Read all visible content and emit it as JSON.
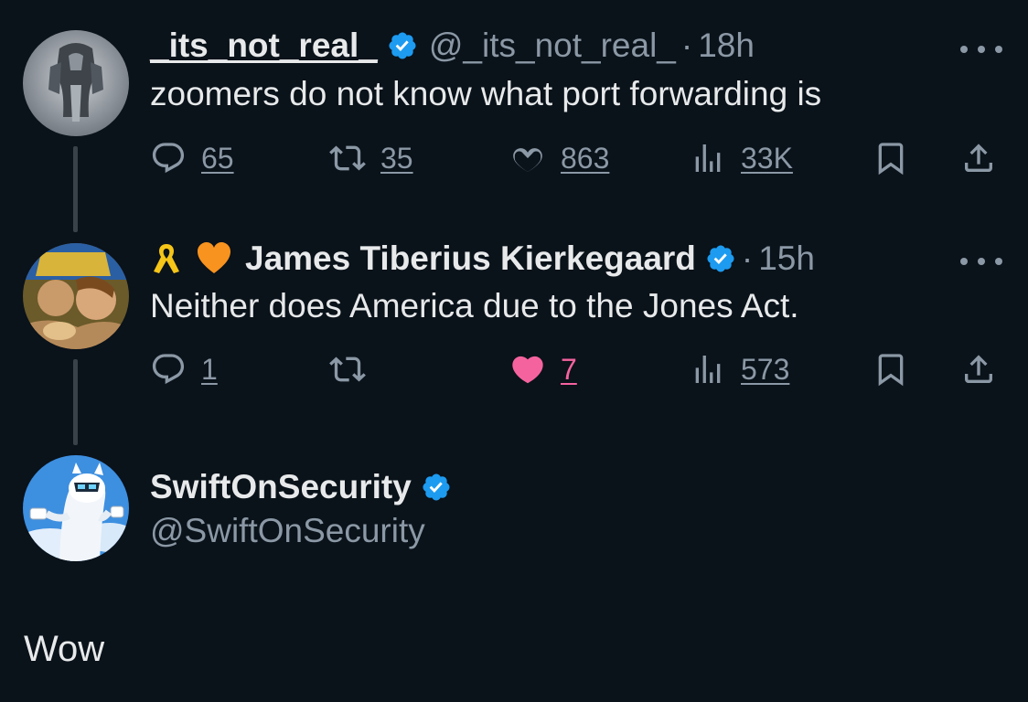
{
  "tweets": [
    {
      "name": "_its_not_real_",
      "handle": "@_its_not_real_",
      "separator": "·",
      "time": "18h",
      "text": "zoomers do not know what port forwarding is",
      "reply_count": "65",
      "retweet_count": "35",
      "like_count": "863",
      "view_count": "33K",
      "liked": false
    },
    {
      "name": "James Tiberius Kierkegaard",
      "name_emoji": [
        "yellow-ribbon",
        "orange-heart"
      ],
      "separator": "·",
      "time": "15h",
      "text": "Neither does America due to the Jones Act.",
      "reply_count": "1",
      "like_count": "7",
      "view_count": "573",
      "liked": true
    }
  ],
  "author": {
    "name": "SwiftOnSecurity",
    "handle": "@SwiftOnSecurity"
  },
  "reply": {
    "text": "Wow"
  },
  "colors": {
    "background": "#0a121a",
    "text": "#e7e9ea",
    "muted": "#8b98a5",
    "verified": "#1d9bf0",
    "like_active": "#f5639f"
  },
  "icons": [
    "reply-icon",
    "retweet-icon",
    "like-icon",
    "views-icon",
    "bookmark-icon",
    "share-icon",
    "verified-badge-icon",
    "more-icon"
  ]
}
